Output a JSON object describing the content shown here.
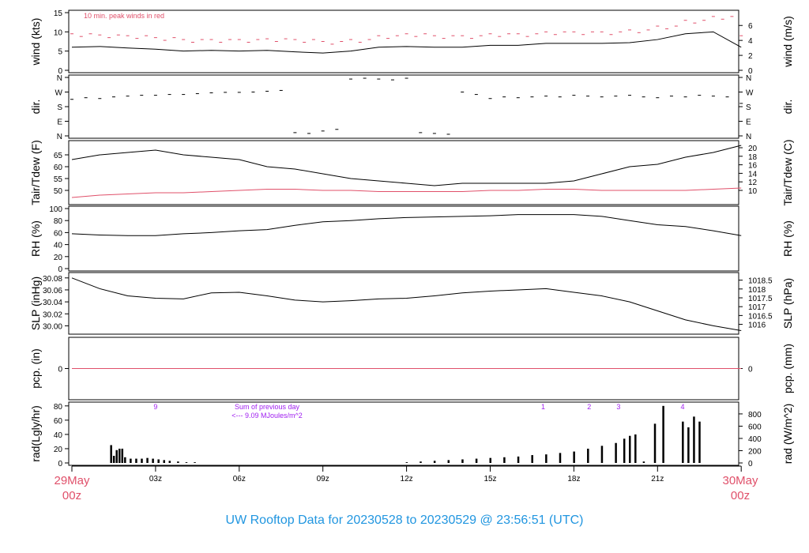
{
  "title": "UW Rooftop Data for 20230528  to  20230529 @ 23:56:51  (UTC)",
  "start_label": [
    "29May",
    "00z"
  ],
  "end_label": [
    "30May",
    "00z"
  ],
  "colors": {
    "line": "#000000",
    "red": "#e0506a",
    "purple": "#a020f0",
    "title": "#2196e0"
  },
  "chart_data": [
    {
      "type": "line",
      "name": "wind",
      "ylabel": "wind (kts)",
      "ylabel2": "wind (m/s)",
      "ylim": [
        0,
        15
      ],
      "yticks": [
        0,
        5,
        10,
        15
      ],
      "y2ticks": [
        0,
        2,
        4,
        6
      ],
      "y2factor": 1.944,
      "note": "10 min. peak winds in red",
      "x": [
        0,
        1,
        2,
        3,
        4,
        5,
        6,
        7,
        8,
        9,
        10,
        11,
        12,
        13,
        14,
        15,
        16,
        17,
        18,
        19,
        20,
        21,
        22,
        23,
        24
      ],
      "series": [
        {
          "name": "wind",
          "values": [
            6,
            6.2,
            5.8,
            5.5,
            5,
            5.2,
            5,
            5.2,
            4.8,
            4.5,
            5,
            6,
            6.2,
            6,
            6,
            6.5,
            6.5,
            7,
            7,
            7,
            7.2,
            8,
            9.5,
            10,
            6
          ]
        },
        {
          "name": "peak",
          "values": [
            9.5,
            9.2,
            9,
            8.5,
            8,
            8,
            8,
            8.2,
            8,
            7.5,
            8,
            9,
            9.5,
            9,
            9,
            9.5,
            9.5,
            10,
            10,
            10,
            10.5,
            11.5,
            13,
            14,
            9
          ]
        }
      ]
    },
    {
      "type": "scatter",
      "name": "dir",
      "ylabel": "dir.",
      "ylabel2": "dir.",
      "yticklabels": [
        "N",
        "E",
        "S",
        "W",
        "N"
      ],
      "ylim": [
        0,
        360
      ],
      "x": [
        0,
        0.5,
        1,
        1.5,
        2,
        2.5,
        3,
        3.5,
        4,
        4.5,
        5,
        5.5,
        6,
        6.5,
        7,
        7.5,
        8,
        8.5,
        9,
        9.5,
        10,
        10.5,
        11,
        11.5,
        12,
        12.5,
        13,
        13.5,
        14,
        14.5,
        15,
        15.5,
        16,
        16.5,
        17,
        17.5,
        18,
        18.5,
        19,
        19.5,
        20,
        20.5,
        21,
        21.5,
        22,
        22.5,
        23,
        23.5,
        24
      ],
      "values": [
        225,
        235,
        230,
        240,
        245,
        250,
        250,
        255,
        255,
        260,
        265,
        268,
        268,
        270,
        275,
        280,
        20,
        15,
        30,
        40,
        350,
        355,
        350,
        345,
        355,
        20,
        15,
        10,
        270,
        255,
        230,
        240,
        235,
        240,
        245,
        240,
        250,
        245,
        240,
        245,
        250,
        240,
        235,
        245,
        240,
        250,
        245,
        240,
        200
      ]
    },
    {
      "type": "line",
      "name": "tair",
      "ylabel": "Tair/Tdew (F)",
      "ylabel2": "Tair/Tdew (C)",
      "ylim": [
        45,
        70
      ],
      "yticks": [
        50,
        55,
        60,
        65
      ],
      "y2ticks": [
        10,
        12,
        14,
        16,
        18,
        20
      ],
      "x": [
        0,
        1,
        2,
        3,
        4,
        5,
        6,
        7,
        8,
        9,
        10,
        11,
        12,
        13,
        14,
        15,
        16,
        17,
        18,
        19,
        20,
        21,
        22,
        23,
        24
      ],
      "series": [
        {
          "name": "Tair",
          "values": [
            63,
            65,
            66,
            67,
            65,
            64,
            63,
            60,
            59,
            57,
            55,
            54,
            53,
            52,
            53,
            53,
            53,
            53,
            54,
            57,
            60,
            61,
            64,
            66,
            69
          ]
        },
        {
          "name": "Tdew",
          "values": [
            47,
            48,
            48.5,
            49,
            49,
            49.5,
            50,
            50.5,
            50.5,
            50,
            50,
            49.5,
            49.5,
            49.5,
            49.5,
            50,
            50,
            50.5,
            50.5,
            50,
            50,
            50,
            50,
            50.5,
            51
          ]
        }
      ]
    },
    {
      "type": "line",
      "name": "rh",
      "ylabel": "RH (%)",
      "ylabel2": "RH (%)",
      "ylim": [
        0,
        100
      ],
      "yticks": [
        0,
        20,
        40,
        60,
        80,
        100
      ],
      "x": [
        0,
        1,
        2,
        3,
        4,
        5,
        6,
        7,
        8,
        9,
        10,
        11,
        12,
        13,
        14,
        15,
        16,
        17,
        18,
        19,
        20,
        21,
        22,
        23,
        24
      ],
      "series": [
        {
          "name": "RH",
          "values": [
            58,
            56,
            55,
            55,
            58,
            60,
            63,
            65,
            72,
            78,
            80,
            83,
            85,
            86,
            87,
            88,
            90,
            90,
            90,
            87,
            80,
            73,
            70,
            63,
            55
          ]
        }
      ]
    },
    {
      "type": "line",
      "name": "slp",
      "ylabel": "SLP (inHg)",
      "ylabel2": "SLP (hPa)",
      "ylim": [
        29.99,
        30.085
      ],
      "yticks": [
        30.0,
        30.02,
        30.04,
        30.06,
        30.08
      ],
      "y2ticks": [
        1016,
        1016.5,
        1017,
        1017.5,
        1018,
        1018.5
      ],
      "x": [
        0,
        1,
        2,
        3,
        4,
        5,
        6,
        7,
        8,
        9,
        10,
        11,
        12,
        13,
        14,
        15,
        16,
        17,
        18,
        19,
        20,
        21,
        22,
        23,
        24
      ],
      "series": [
        {
          "name": "SLP",
          "values": [
            30.08,
            30.062,
            30.05,
            30.046,
            30.045,
            30.055,
            30.056,
            30.05,
            30.043,
            30.04,
            30.042,
            30.045,
            30.046,
            30.05,
            30.055,
            30.058,
            30.06,
            30.062,
            30.056,
            30.05,
            30.04,
            30.025,
            30.01,
            30.0,
            29.992
          ]
        }
      ]
    },
    {
      "type": "line",
      "name": "pcp",
      "ylabel": "pcp. (in)",
      "ylabel2": "pcp. (mm)",
      "ylim": [
        -1,
        1
      ],
      "yticks": [
        0
      ],
      "y2ticks": [
        0
      ],
      "x": [
        0,
        24
      ],
      "series": [
        {
          "name": "pcp",
          "values": [
            0,
            0
          ]
        }
      ]
    },
    {
      "type": "bar",
      "name": "rad",
      "ylabel": "rad(Lgly/hr)",
      "ylabel2": "rad (W/m^2)",
      "ylim": [
        0,
        82
      ],
      "yticks": [
        0,
        20,
        40,
        60,
        80
      ],
      "y2ticks": [
        0,
        200,
        400,
        600,
        800
      ],
      "y2factor": 11.63,
      "x": [
        1.4,
        1.5,
        1.6,
        1.7,
        1.8,
        1.9,
        2.1,
        2.3,
        2.5,
        2.7,
        2.9,
        3.1,
        3.3,
        3.5,
        3.8,
        4.1,
        4.4,
        12,
        12.5,
        13,
        13.5,
        14,
        14.5,
        15,
        15.5,
        16,
        16.5,
        17,
        17.5,
        18,
        18.5,
        19,
        19.5,
        19.8,
        20,
        20.2,
        20.5,
        20.9,
        21.2,
        21.9,
        22.1,
        22.3,
        22.5
      ],
      "values": [
        25,
        10,
        18,
        20,
        20,
        8,
        6,
        6,
        6,
        7,
        6,
        5,
        4,
        3,
        2,
        1,
        1,
        1,
        2,
        3,
        4,
        5,
        6,
        7,
        8,
        9,
        11,
        12,
        14,
        16,
        20,
        24,
        28,
        34,
        38,
        40,
        2,
        55,
        80,
        58,
        50,
        65,
        58
      ],
      "annotations": [
        "9",
        "1",
        "2",
        "3",
        "4"
      ],
      "annotation_x": [
        3,
        16.9,
        18.55,
        19.6,
        21.9
      ],
      "sum_text": [
        "Sum of previous day",
        "<--- 9.09 MJoules/m^2"
      ]
    },
    {
      "type": "axis",
      "xticks": [
        "03z",
        "06z",
        "09z",
        "12z",
        "15z",
        "18z",
        "21z"
      ],
      "xtick_hours": [
        3,
        6,
        9,
        12,
        15,
        18,
        21
      ]
    }
  ]
}
